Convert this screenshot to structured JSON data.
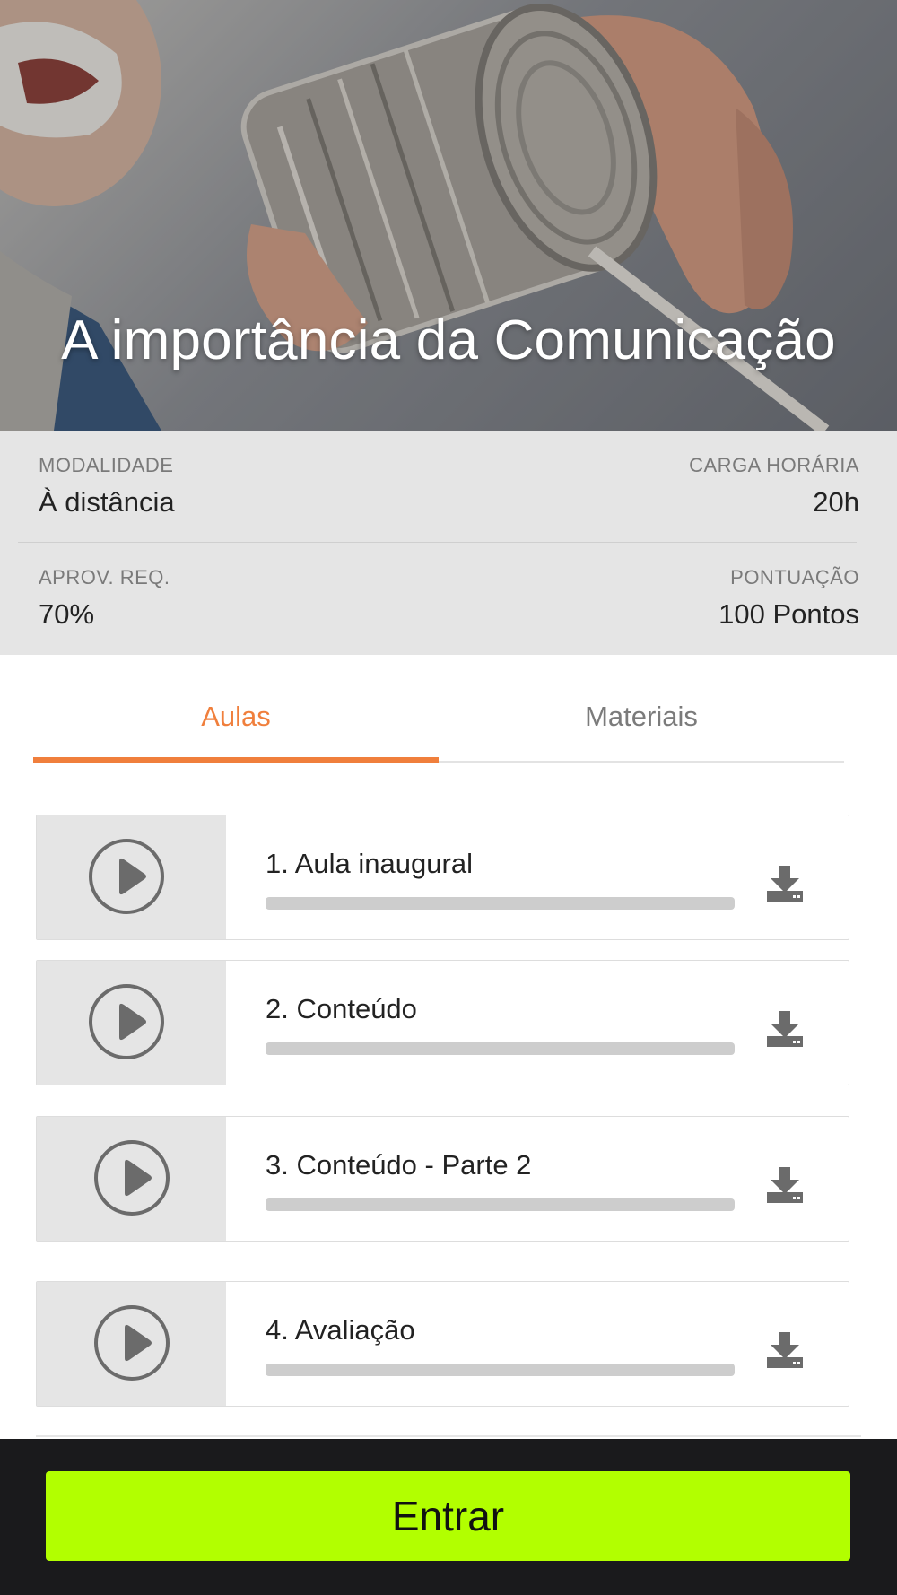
{
  "course": {
    "title": "A importância da Comunicação"
  },
  "info": {
    "modalidade_label": "MODALIDADE",
    "modalidade_value": "À distância",
    "carga_label": "CARGA HORÁRIA",
    "carga_value": "20h",
    "aprov_label": "APROV. REQ.",
    "aprov_value": "70%",
    "pontuacao_label": "PONTUAÇÃO",
    "pontuacao_value": "100 Pontos"
  },
  "tabs": [
    {
      "label": "Aulas",
      "active": true
    },
    {
      "label": "Materiais",
      "active": false
    }
  ],
  "lessons": [
    {
      "title": "1. Aula inaugural",
      "progress": 0,
      "icon": "play-icon",
      "action_icon": "download-icon"
    },
    {
      "title": "2. Conteúdo",
      "progress": 0,
      "icon": "play-icon",
      "action_icon": "download-icon"
    },
    {
      "title": "3. Conteúdo - Parte 2",
      "progress": 0,
      "icon": "play-icon",
      "action_icon": "download-icon"
    },
    {
      "title": "4. Avaliação",
      "progress": 0,
      "icon": "play-icon",
      "action_icon": "download-icon"
    }
  ],
  "footer": {
    "enter_label": "Entrar"
  },
  "colors": {
    "accent": "#f07f3c",
    "enter_button": "#b2ff00",
    "footer_bg": "#1a1a1c",
    "info_bg": "#e5e5e5"
  }
}
